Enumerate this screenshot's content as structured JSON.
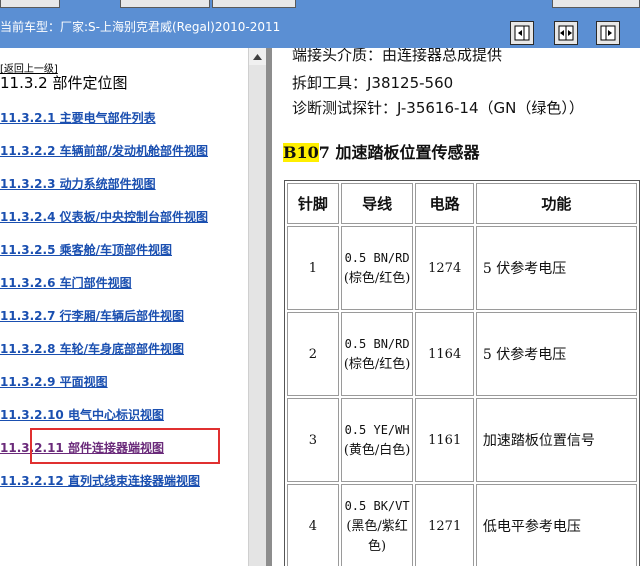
{
  "header": {
    "vehicle_label": "当前车型：厂家:S-上海别克君威(Regal)2010-2011",
    "buttons": [
      {
        "name": "left-pane-button",
        "icon": "pane-left-icon"
      },
      {
        "name": "split-pane-button",
        "icon": "pane-split-icon"
      },
      {
        "name": "right-pane-button",
        "icon": "pane-right-icon"
      }
    ]
  },
  "nav": {
    "back_label": "[返回上一级]",
    "section_title": "11.3.2 部件定位图",
    "links": [
      "11.3.2.1 主要电气部件列表",
      "11.3.2.2 车辆前部/发动机舱部件视图",
      "11.3.2.3 动力系统部件视图",
      "11.3.2.4 仪表板/中央控制台部件视图",
      "11.3.2.5 乘客舱/车顶部件视图",
      "11.3.2.6 车门部件视图",
      "11.3.2.7 行李厢/车辆后部件视图",
      "11.3.2.8 车轮/车身底部部件视图",
      "11.3.2.9 平面视图",
      "11.3.2.10 电气中心标识视图",
      "11.3.2.11 部件连接器端视图",
      "11.3.2.12 直列式线束连接器端视图"
    ]
  },
  "content": {
    "clipped_line": "端接头介质：由连接器总成提供",
    "tool_line": "拆卸工具：J38125-560",
    "probe_line": "诊断测试探针：J-35616-14（GN（绿色））",
    "heading_code": "B10",
    "heading_rest": "7 加速踏板位置传感器",
    "table": {
      "headers": [
        "针脚",
        "导线",
        "电路",
        "功能"
      ],
      "rows": [
        {
          "pin": "1",
          "wire_code": "0.5 BN/RD",
          "wire_color": "(棕色/红色)",
          "circuit": "1274",
          "function": "5 伏参考电压"
        },
        {
          "pin": "2",
          "wire_code": "0.5 BN/RD",
          "wire_color": "(棕色/红色)",
          "circuit": "1164",
          "function": "5 伏参考电压"
        },
        {
          "pin": "3",
          "wire_code": "0.5 YE/WH",
          "wire_color": "(黄色/白色)",
          "circuit": "1161",
          "function": "加速踏板位置信号"
        },
        {
          "pin": "4",
          "wire_code": "0.5 BK/VT",
          "wire_color": "(黑色/紫红色)",
          "circuit": "1271",
          "function": "低电平参考电压"
        }
      ]
    }
  },
  "colors": {
    "header_bg": "#5b8fd3",
    "link": "#1a4fb0",
    "visited_link": "#6a2a7a",
    "highlight_box": "#e03030",
    "code_highlight": "#ffef00"
  }
}
